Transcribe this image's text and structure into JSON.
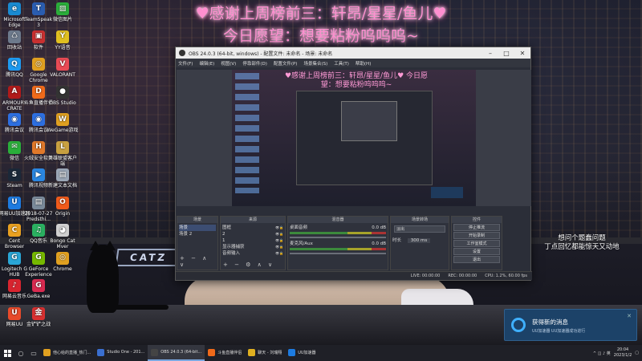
{
  "banner": {
    "line1": "♥感谢上周榜前三：轩昂/星星/鱼儿♥",
    "line2": "今日愿望：想要粘粉呜呜呜~"
  },
  "overlay_text": {
    "line1": "想问个题蠢问题",
    "line2": "丁点回忆都能惊天又动地"
  },
  "desktop_icons": {
    "col1": [
      {
        "label": "Microsoft Edge",
        "color": "#1a8ad0",
        "glyph": "e"
      },
      {
        "label": "回收站",
        "color": "#6d7a8c",
        "glyph": "♺"
      },
      {
        "label": "腾讯QQ",
        "color": "#1e9af0",
        "glyph": "Q"
      },
      {
        "label": "ARMOURY CRATE",
        "color": "#b01a1a",
        "glyph": "A"
      },
      {
        "label": "腾讯会议",
        "color": "#2d6fe0",
        "glyph": "◉"
      },
      {
        "label": "微信",
        "color": "#2aae3a",
        "glyph": "✉"
      },
      {
        "label": "Steam",
        "color": "#1b2838",
        "glyph": "S"
      },
      {
        "label": "网易UU加速器",
        "color": "#1d7be0",
        "glyph": "U"
      },
      {
        "label": "Cent Browser",
        "color": "#e8a020",
        "glyph": "C"
      },
      {
        "label": "Logitech G HUB",
        "color": "#2aa6d6",
        "glyph": "G"
      },
      {
        "label": "网易云音乐",
        "color": "#d8242f",
        "glyph": "♪"
      },
      {
        "label": "网易UU",
        "color": "#e84a2a",
        "glyph": "U"
      }
    ],
    "col2": [
      {
        "label": "TeamSpeak 3",
        "color": "#2a5db0",
        "glyph": "T"
      },
      {
        "label": "软件",
        "color": "#c83030",
        "glyph": "▣"
      },
      {
        "label": "Google Chrome",
        "color": "#e0a020",
        "glyph": "◎"
      },
      {
        "label": "斗鱼直播伴侣",
        "color": "#f06a1a",
        "glyph": "D"
      },
      {
        "label": "腾讯会议",
        "color": "#2d6fe0",
        "glyph": "◉"
      },
      {
        "label": "火绒安全软件",
        "color": "#e0792a",
        "glyph": "H"
      },
      {
        "label": "腾讯视频",
        "color": "#2a86e0",
        "glyph": "▶"
      },
      {
        "label": "2018-07-27 Predsthi...",
        "color": "#7a8a9a",
        "glyph": "▤"
      },
      {
        "label": "QQ音乐",
        "color": "#2ab060",
        "glyph": "♫"
      },
      {
        "label": "GeForce Experience",
        "color": "#76b900",
        "glyph": "G"
      },
      {
        "label": "GeBa.exe",
        "color": "#d82a50",
        "glyph": "G"
      },
      {
        "label": "金铲铲之战",
        "color": "#d83030",
        "glyph": "金"
      }
    ],
    "col3": [
      {
        "label": "微信图片",
        "color": "#2aae3a",
        "glyph": "▨"
      },
      {
        "label": "YY语音",
        "color": "#e0c020",
        "glyph": "Y"
      },
      {
        "label": "VALORANT",
        "color": "#e84a54",
        "glyph": "V"
      },
      {
        "label": "OBS Studio",
        "color": "#333333",
        "glyph": "●"
      },
      {
        "label": "WeGame游戏",
        "color": "#e0a020",
        "glyph": "W"
      },
      {
        "label": "英雄联盟客户端",
        "color": "#c8a040",
        "glyph": "L"
      },
      {
        "label": "新建文本文档",
        "color": "#9aa6b6",
        "glyph": "▤"
      },
      {
        "label": "Origin",
        "color": "#f05a1a",
        "glyph": "O"
      },
      {
        "label": "Bongo Cat Mver",
        "color": "#d0d0d0",
        "glyph": "◕"
      },
      {
        "label": "Chrome",
        "color": "#e0a020",
        "glyph": "◎"
      }
    ]
  },
  "obs": {
    "title": "OBS 24.0.3 (64-bit, windows) - 配置文件: 未命名 - 场景: 未命名",
    "menu": [
      "文件(F)",
      "编辑(E)",
      "视图(V)",
      "停靠部件(D)",
      "配置文件(P)",
      "场景集合(S)",
      "工具(T)",
      "帮助(H)"
    ],
    "preview_banner": "♥感谢上周榜前三：轩昂/星星/鱼儿♥ 今日愿望：想要粘粉呜呜呜~",
    "docks": {
      "scenes_title": "场景",
      "scenes": [
        "场景",
        "场景 2"
      ],
      "sources_title": "来源",
      "sources": [
        "图框",
        "2",
        "1",
        "显示器捕获",
        "音频输入"
      ],
      "mixer_title": "混音器",
      "mixer": [
        {
          "name": "桌面音频",
          "db": "0.0 dB"
        },
        {
          "name": "麦克风/Aux",
          "db": "0.0 dB"
        }
      ],
      "transitions_title": "场景转场",
      "transition": "淡出",
      "duration_label": "时长",
      "duration_value": "300 ms",
      "controls_title": "控件",
      "controls": [
        "停止推流",
        "开始录制",
        "工作室模式",
        "设置",
        "退出"
      ]
    },
    "status": {
      "live": "LIVE: 00:00:00",
      "rec": "REC: 00:00:00",
      "cpu": "CPU: 1.2%, 60.00 fps"
    }
  },
  "notification": {
    "title": "获得新的消息",
    "subtitle": "UU加速器 UU加速器成功进行"
  },
  "taskbar": {
    "tasks": [
      {
        "label": "他心给的直播_热门...",
        "color": "#e0a020",
        "active": false
      },
      {
        "label": "Studio One - 201...",
        "color": "#3a6fd0",
        "active": false
      },
      {
        "label": "OBS 24.0.3 (64-bit...",
        "color": "#444",
        "active": true
      },
      {
        "label": "斗鱼直播伴侣",
        "color": "#f06a1a",
        "active": false
      },
      {
        "label": "聊天 - 刘瑞翔",
        "color": "#e0b020",
        "active": false
      },
      {
        "label": "UU加速器",
        "color": "#1d7be0",
        "active": false
      }
    ],
    "tray_text": "^ ◫ ♪ 英",
    "time": "20:04",
    "date": "2023/1/2"
  }
}
